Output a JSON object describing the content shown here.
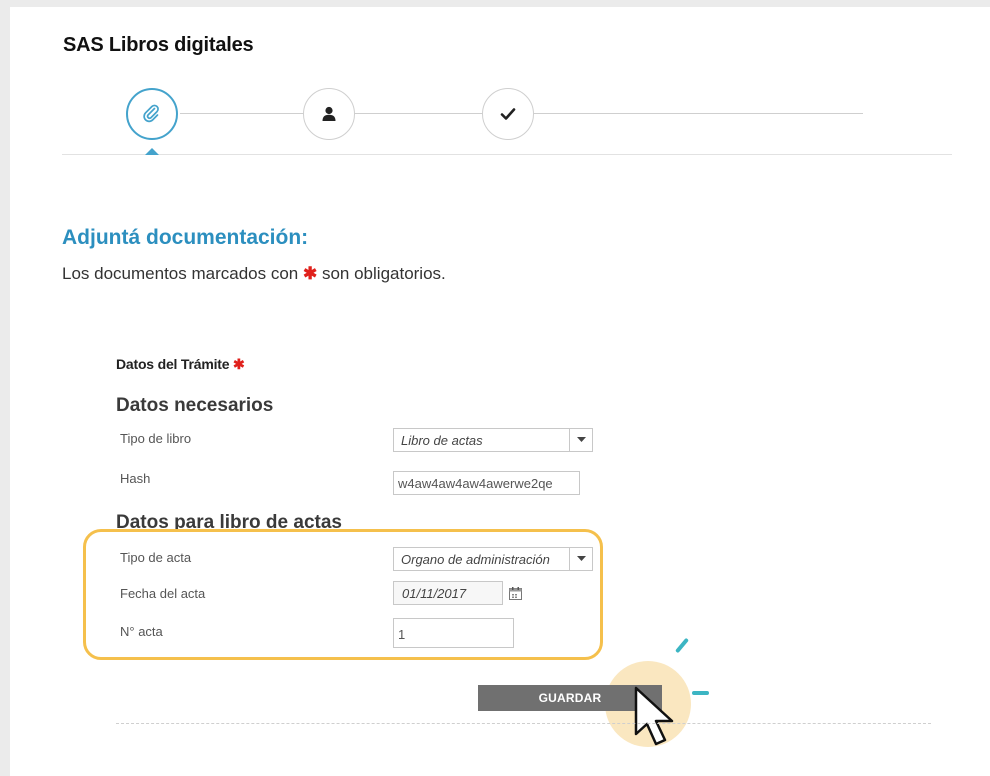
{
  "app": {
    "title": "SAS Libros digitales"
  },
  "stepper": {
    "steps": [
      {
        "icon": "paperclip-icon",
        "active": true
      },
      {
        "icon": "user-icon",
        "active": false
      },
      {
        "icon": "checkmark-icon",
        "active": false
      }
    ]
  },
  "section": {
    "heading": "Adjuntá documentación:",
    "subtitle_before": "Los documentos marcados con",
    "subtitle_star": "✱",
    "subtitle_after": "son obligatorios."
  },
  "form": {
    "block_title": "Datos del Trámite",
    "required_mark": "✱",
    "group1_title": "Datos necesarios",
    "group2_title": "Datos para libro de actas",
    "fields": {
      "tipo_libro": {
        "label": "Tipo de libro",
        "value": "Libro de actas"
      },
      "hash": {
        "label": "Hash",
        "value": "w4aw4aw4aw4awerwe2qe"
      },
      "tipo_acta": {
        "label": "Tipo de acta",
        "value": "Organo de administración"
      },
      "fecha_acta": {
        "label": "Fecha del acta",
        "value": "01/11/2017"
      },
      "nro_acta": {
        "label": "N° acta",
        "value": "1"
      }
    },
    "save_label": "GUARDAR"
  },
  "colors": {
    "accent": "#2c8fbf",
    "required": "#e0201b",
    "highlight": "#f5c04c",
    "button": "#707070"
  }
}
